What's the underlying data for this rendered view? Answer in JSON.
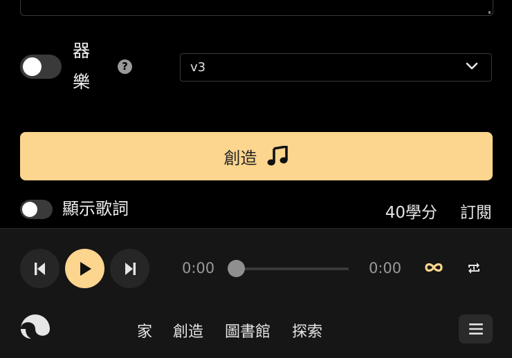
{
  "instrumental": {
    "line1": "器",
    "line2": "樂"
  },
  "model_select": {
    "value": "v3"
  },
  "create_button": {
    "label": "創造",
    "icon": "music-note-icon"
  },
  "lyrics_toggle": {
    "label": "顯示歌詞"
  },
  "credits": {
    "text": "40學分"
  },
  "subscribe": {
    "label": "訂閱"
  },
  "player": {
    "current_time": "0:00",
    "duration": "0:00",
    "progress": 0,
    "accent_color": "#fcd58e"
  },
  "nav": {
    "home": "家",
    "create": "創造",
    "library": "圖書館",
    "explore": "探索"
  },
  "colors": {
    "accent": "#fcd58e",
    "background": "#000000",
    "player_bar": "#161616"
  }
}
